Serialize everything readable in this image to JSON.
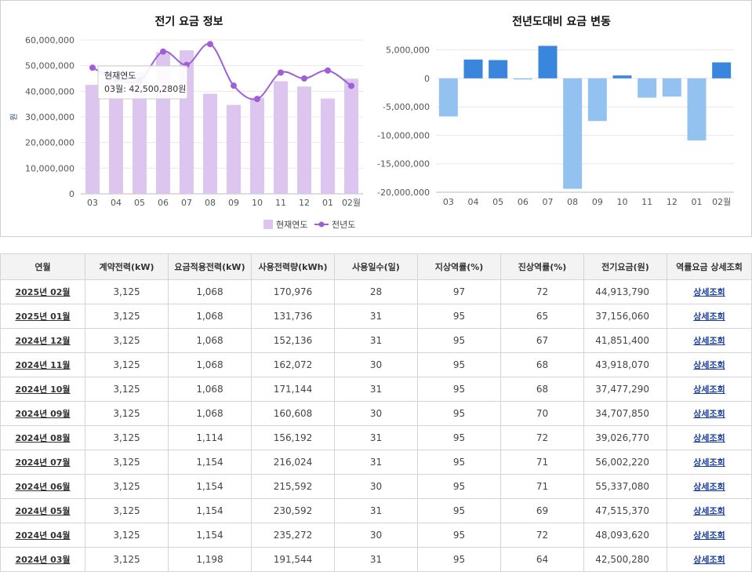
{
  "chart_data": [
    {
      "type": "bar+line",
      "title": "전기 요금 정보",
      "ylabel": "원",
      "categories": [
        "03",
        "04",
        "05",
        "06",
        "07",
        "08",
        "09",
        "10",
        "11",
        "12",
        "01",
        "02월"
      ],
      "ylim": [
        0,
        60000000
      ],
      "yticks": [
        "0",
        "10,000,000",
        "20,000,000",
        "30,000,000",
        "40,000,000",
        "50,000,000",
        "60,000,000"
      ],
      "series": [
        {
          "name": "현재연도",
          "kind": "bar",
          "color": "#dcc6f0",
          "values": [
            42500280,
            48093620,
            47515370,
            55337080,
            56002220,
            39026770,
            34707850,
            37477290,
            43918070,
            41851400,
            37156060,
            44913790
          ]
        },
        {
          "name": "전년도",
          "kind": "line",
          "color": "#a05fd6",
          "values": [
            49200000,
            44800000,
            44300000,
            55500000,
            50300000,
            58400000,
            42200000,
            37000000,
            47300000,
            45000000,
            48100000,
            42100000
          ]
        }
      ],
      "legend": "bottom-right",
      "tooltip": {
        "series": "현재연도",
        "text": "03월: 42,500,280원"
      }
    },
    {
      "type": "bar",
      "title": "전년도대비 요금 변동",
      "categories": [
        "03",
        "04",
        "05",
        "06",
        "07",
        "08",
        "09",
        "10",
        "11",
        "12",
        "01",
        "02월"
      ],
      "ylim": [
        -20000000,
        7000000
      ],
      "yticks": [
        "-20,000,000",
        "-15,000,000",
        "-10,000,000",
        "-5,000,000",
        "0",
        "5,000,000"
      ],
      "values": [
        -6700000,
        3300000,
        3200000,
        -200000,
        5700000,
        -19400000,
        -7500000,
        500000,
        -3400000,
        -3200000,
        -10900000,
        2800000
      ],
      "positive_color": "#3a86dc",
      "negative_color": "#94c2f0"
    }
  ],
  "table": {
    "headers": [
      "연월",
      "계약전력(kW)",
      "요금적용전력(kW)",
      "사용전력량(kWh)",
      "사용일수(일)",
      "지상역률(%)",
      "진상역률(%)",
      "전기요금(원)",
      "역률요금 상세조회"
    ],
    "link_label": "상세조회",
    "rows": [
      {
        "month": "2025년 02월",
        "contract": "3,125",
        "applied": "1,068",
        "usage": "170,976",
        "days": "28",
        "lag": "97",
        "lead": "72",
        "fee": "44,913,790"
      },
      {
        "month": "2025년 01월",
        "contract": "3,125",
        "applied": "1,068",
        "usage": "131,736",
        "days": "31",
        "lag": "95",
        "lead": "65",
        "fee": "37,156,060"
      },
      {
        "month": "2024년 12월",
        "contract": "3,125",
        "applied": "1,068",
        "usage": "152,136",
        "days": "31",
        "lag": "95",
        "lead": "67",
        "fee": "41,851,400"
      },
      {
        "month": "2024년 11월",
        "contract": "3,125",
        "applied": "1,068",
        "usage": "162,072",
        "days": "30",
        "lag": "95",
        "lead": "68",
        "fee": "43,918,070"
      },
      {
        "month": "2024년 10월",
        "contract": "3,125",
        "applied": "1,068",
        "usage": "171,144",
        "days": "31",
        "lag": "95",
        "lead": "68",
        "fee": "37,477,290"
      },
      {
        "month": "2024년 09월",
        "contract": "3,125",
        "applied": "1,068",
        "usage": "160,608",
        "days": "30",
        "lag": "95",
        "lead": "70",
        "fee": "34,707,850"
      },
      {
        "month": "2024년 08월",
        "contract": "3,125",
        "applied": "1,114",
        "usage": "156,192",
        "days": "31",
        "lag": "95",
        "lead": "72",
        "fee": "39,026,770"
      },
      {
        "month": "2024년 07월",
        "contract": "3,125",
        "applied": "1,154",
        "usage": "216,024",
        "days": "31",
        "lag": "95",
        "lead": "71",
        "fee": "56,002,220"
      },
      {
        "month": "2024년 06월",
        "contract": "3,125",
        "applied": "1,154",
        "usage": "215,592",
        "days": "30",
        "lag": "95",
        "lead": "71",
        "fee": "55,337,080"
      },
      {
        "month": "2024년 05월",
        "contract": "3,125",
        "applied": "1,154",
        "usage": "230,592",
        "days": "31",
        "lag": "95",
        "lead": "69",
        "fee": "47,515,370"
      },
      {
        "month": "2024년 04월",
        "contract": "3,125",
        "applied": "1,154",
        "usage": "235,272",
        "days": "30",
        "lag": "95",
        "lead": "72",
        "fee": "48,093,620"
      },
      {
        "month": "2024년 03월",
        "contract": "3,125",
        "applied": "1,198",
        "usage": "191,544",
        "days": "31",
        "lag": "95",
        "lead": "64",
        "fee": "42,500,280"
      }
    ]
  }
}
